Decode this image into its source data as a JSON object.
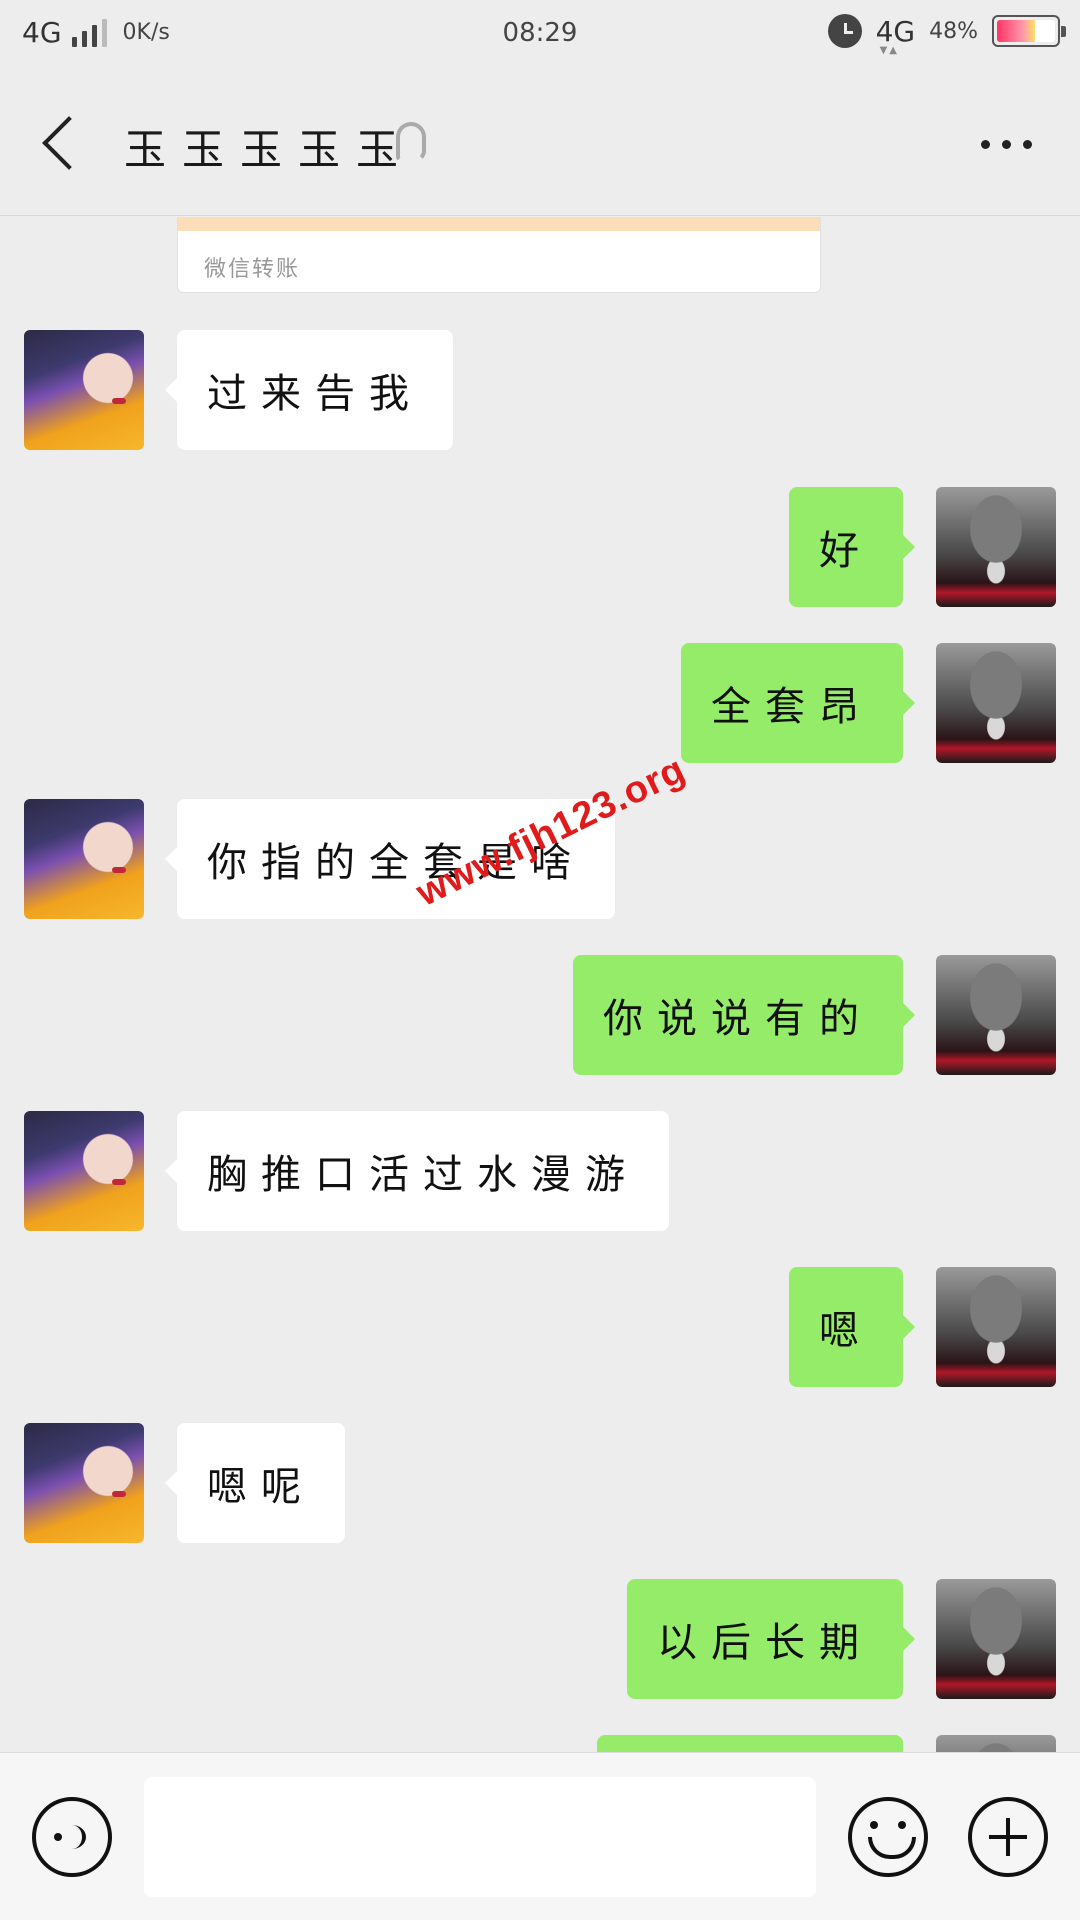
{
  "status_bar": {
    "network": "4G",
    "speed": "0K/s",
    "time": "08:29",
    "network_right": "4G",
    "battery_percent": "48%"
  },
  "header": {
    "title": "玉玉玉玉玉"
  },
  "transfer": {
    "label": "微信转账"
  },
  "messages": [
    {
      "side": "in",
      "text": "过来告我"
    },
    {
      "side": "out",
      "text": "好"
    },
    {
      "side": "out",
      "text": "全套昂"
    },
    {
      "side": "in",
      "text": "你指的全套是啥"
    },
    {
      "side": "out",
      "text": "你说说有的"
    },
    {
      "side": "in",
      "text": "胸推口活过水漫游"
    },
    {
      "side": "out",
      "text": "嗯"
    },
    {
      "side": "in",
      "text": "嗯呢"
    },
    {
      "side": "out",
      "text": "以后长期"
    }
  ],
  "watermark": "www.fjh123.org",
  "colors": {
    "background": "#ededed",
    "outgoing_bubble": "#95ec69",
    "incoming_bubble": "#ffffff",
    "watermark": "#e01b1b"
  }
}
